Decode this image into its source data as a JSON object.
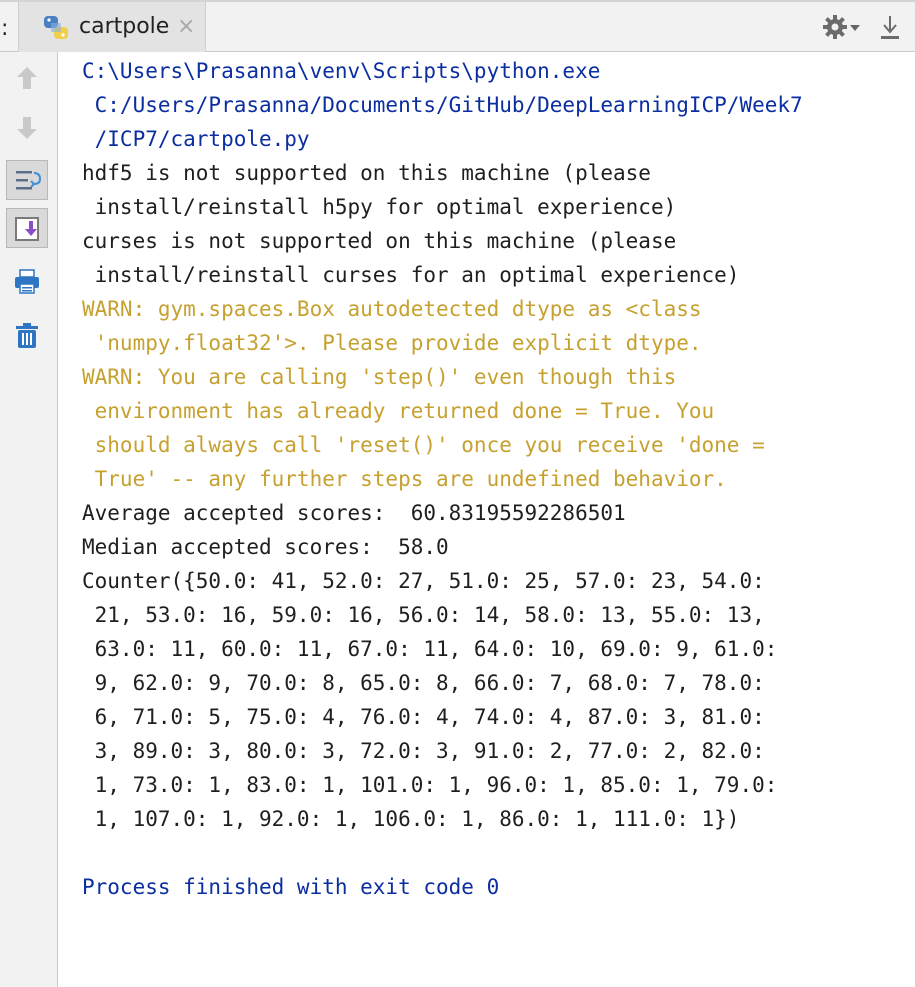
{
  "tab": {
    "prefix": ":",
    "label": "cartpole",
    "close": "×"
  },
  "icons": {
    "tab": "python-file-icon",
    "settings": "gear-icon",
    "download": "download-icon",
    "toolbar": [
      "arrow-up-icon",
      "arrow-down-icon",
      "soft-wrap-icon",
      "scroll-to-end-icon",
      "print-icon",
      "trash-icon"
    ]
  },
  "colors": {
    "path": "#0b2ea0",
    "warning": "#c6a12f",
    "text": "#1f1f1f"
  },
  "console": {
    "lines": [
      {
        "text": "C:\\Users\\Prasanna\\venv\\Scripts\\python.exe",
        "kind": "path"
      },
      {
        "text": " C:/Users/Prasanna/Documents/GitHub/DeepLearningICP/Week7",
        "kind": "path"
      },
      {
        "text": " /ICP7/cartpole.py",
        "kind": "path"
      },
      {
        "text": "hdf5 is not supported on this machine (please",
        "kind": "normal"
      },
      {
        "text": " install/reinstall h5py for optimal experience)",
        "kind": "normal"
      },
      {
        "text": "curses is not supported on this machine (please",
        "kind": "normal"
      },
      {
        "text": " install/reinstall curses for an optimal experience)",
        "kind": "normal"
      },
      {
        "text": "WARN: gym.spaces.Box autodetected dtype as <class",
        "kind": "warn"
      },
      {
        "text": " 'numpy.float32'>. Please provide explicit dtype.",
        "kind": "warn"
      },
      {
        "text": "WARN: You are calling 'step()' even though this",
        "kind": "warn"
      },
      {
        "text": " environment has already returned done = True. You",
        "kind": "warn"
      },
      {
        "text": " should always call 'reset()' once you receive 'done =",
        "kind": "warn"
      },
      {
        "text": " True' -- any further steps are undefined behavior.",
        "kind": "warn"
      },
      {
        "text": "Average accepted scores:  60.83195592286501",
        "kind": "normal"
      },
      {
        "text": "Median accepted scores:  58.0",
        "kind": "normal"
      },
      {
        "text": "Counter({50.0: 41, 52.0: 27, 51.0: 25, 57.0: 23, 54.0:",
        "kind": "normal"
      },
      {
        "text": " 21, 53.0: 16, 59.0: 16, 56.0: 14, 58.0: 13, 55.0: 13,",
        "kind": "normal"
      },
      {
        "text": " 63.0: 11, 60.0: 11, 67.0: 11, 64.0: 10, 69.0: 9, 61.0:",
        "kind": "normal"
      },
      {
        "text": " 9, 62.0: 9, 70.0: 8, 65.0: 8, 66.0: 7, 68.0: 7, 78.0:",
        "kind": "normal"
      },
      {
        "text": " 6, 71.0: 5, 75.0: 4, 76.0: 4, 74.0: 4, 87.0: 3, 81.0:",
        "kind": "normal"
      },
      {
        "text": " 3, 89.0: 3, 80.0: 3, 72.0: 3, 91.0: 2, 77.0: 2, 82.0:",
        "kind": "normal"
      },
      {
        "text": " 1, 73.0: 1, 83.0: 1, 101.0: 1, 96.0: 1, 85.0: 1, 79.0:",
        "kind": "normal"
      },
      {
        "text": " 1, 107.0: 1, 92.0: 1, 106.0: 1, 86.0: 1, 111.0: 1})",
        "kind": "normal"
      },
      {
        "text": "",
        "kind": "normal"
      },
      {
        "text": "Process finished with exit code 0",
        "kind": "done"
      }
    ]
  }
}
